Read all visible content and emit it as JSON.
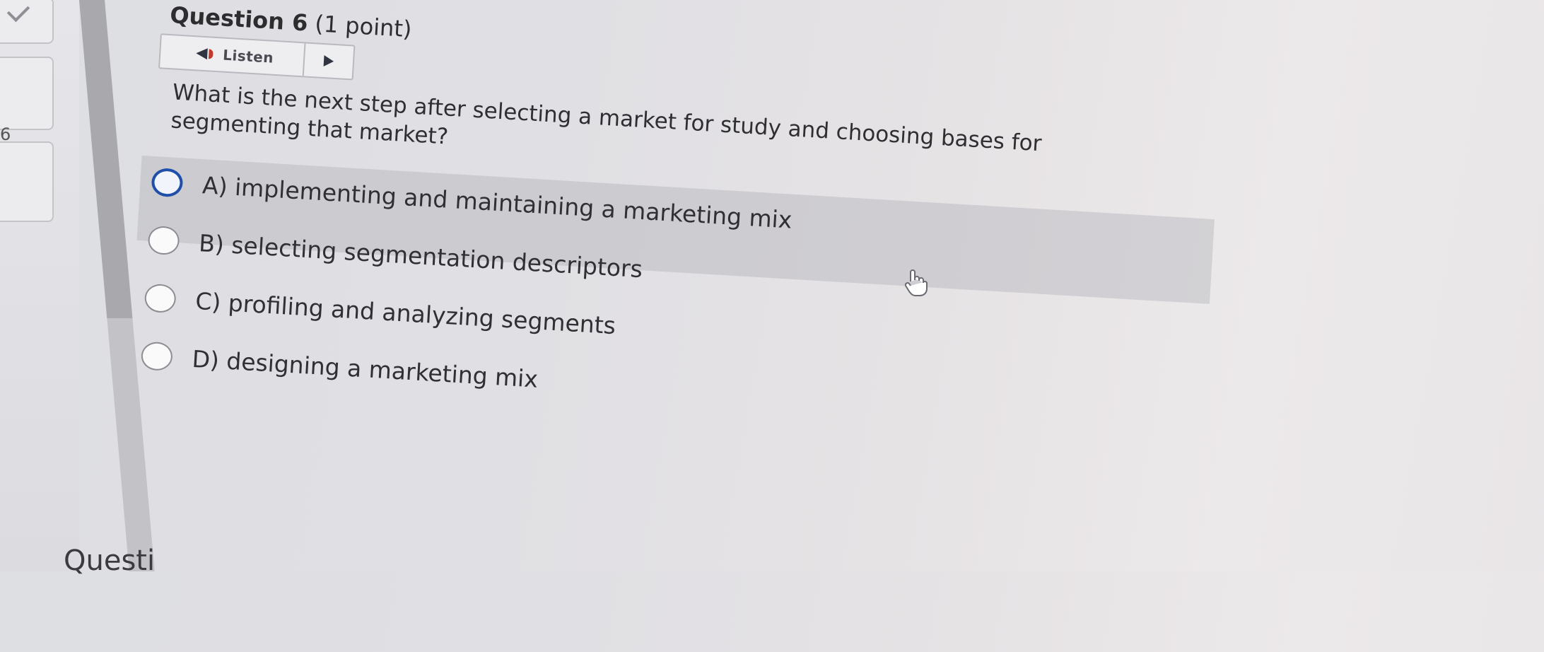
{
  "question": {
    "title": "Question 6",
    "points": "(1 point)",
    "listen_label": "Listen",
    "text": "What is the next step after selecting a market for study and choosing bases for segmenting that market?",
    "options": [
      {
        "letter": "A)",
        "text": "implementing and maintaining a marketing mix",
        "selected": false,
        "focused": true
      },
      {
        "letter": "B)",
        "text": "selecting segmentation descriptors",
        "selected": false,
        "focused": false
      },
      {
        "letter": "C)",
        "text": "profiling and analyzing segments",
        "selected": false,
        "focused": false
      },
      {
        "letter": "D)",
        "text": "designing a marketing mix",
        "selected": false,
        "focused": false
      }
    ]
  },
  "sidebar": {
    "current_number": "6"
  },
  "next_question": {
    "partial_label": "Questi"
  },
  "colors": {
    "focus_ring": "#1f4fa8",
    "hover_band": "#cfcfd4",
    "speaker_accent": "#c0392b"
  },
  "icons": {
    "listen": "speaker-icon",
    "play": "play-icon",
    "nav_done": "checkmark-icon",
    "cursor": "hand-cursor-icon"
  }
}
